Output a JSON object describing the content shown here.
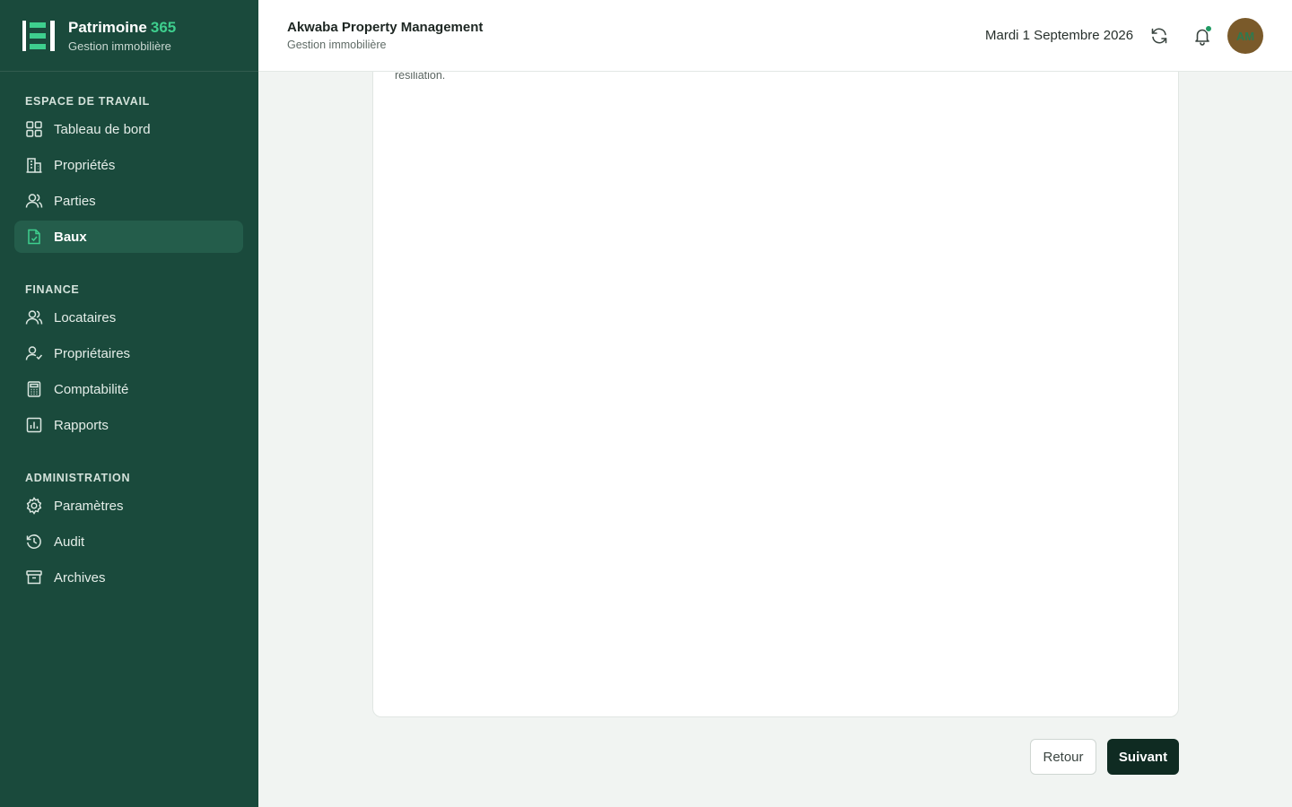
{
  "brand": {
    "title": "Patrimoine",
    "title_accent": "365",
    "subtitle": "Gestion immobilière",
    "logo_icon": "ledger-logo-icon"
  },
  "sidebar": {
    "sections": [
      {
        "title": "ESPACE DE TRAVAIL",
        "items": [
          {
            "label": "Tableau de bord",
            "icon": "grid-icon"
          },
          {
            "label": "Propriétés",
            "icon": "building-icon"
          },
          {
            "label": "Parties",
            "icon": "users-icon"
          },
          {
            "label": "Baux",
            "icon": "document-check-icon",
            "active": true
          }
        ]
      },
      {
        "title": "FINANCE",
        "items": [
          {
            "label": "Locataires",
            "icon": "users-icon"
          },
          {
            "label": "Propriétaires",
            "icon": "user-check-icon"
          },
          {
            "label": "Comptabilité",
            "icon": "calculator-icon"
          },
          {
            "label": "Rapports",
            "icon": "bar-chart-icon"
          }
        ]
      },
      {
        "title": "ADMINISTRATION",
        "items": [
          {
            "label": "Paramètres",
            "icon": "gear-icon"
          },
          {
            "label": "Audit",
            "icon": "history-icon"
          },
          {
            "label": "Archives",
            "icon": "archive-icon"
          }
        ]
      }
    ]
  },
  "header": {
    "org_name": "Akwaba Property Management",
    "org_subtitle": "Gestion immobilière",
    "date": "Mardi 1 Septembre 2026",
    "avatar_initials": "AM"
  },
  "content": {
    "partial_text": "résiliation."
  },
  "footer": {
    "back_label": "Retour",
    "next_label": "Suivant"
  },
  "colors": {
    "sidebar_bg": "#1a4a3c",
    "sidebar_active": "#245d4b",
    "accent": "#3ecf8e",
    "primary_button": "#0f2b22",
    "page_bg": "#f1f4f2"
  }
}
